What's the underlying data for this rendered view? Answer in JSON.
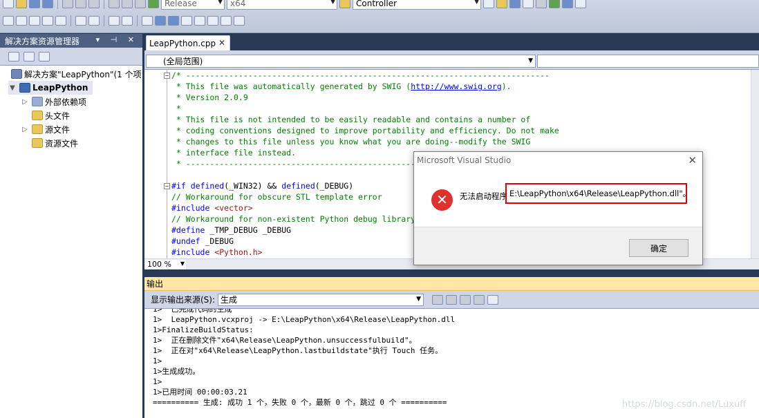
{
  "toolbar": {
    "config": "Release",
    "platform": "x64",
    "find": "Controller"
  },
  "solution_explorer": {
    "title": "解决方案资源管理器",
    "solution": "解决方案\"LeapPython\"(1 个项",
    "project": "LeapPython",
    "items": [
      {
        "label": "外部依赖项",
        "icon": "references-icon",
        "expandable": true
      },
      {
        "label": "头文件",
        "icon": "folder-icon",
        "expandable": false
      },
      {
        "label": "源文件",
        "icon": "folder-icon",
        "expandable": true
      },
      {
        "label": "资源文件",
        "icon": "folder-icon",
        "expandable": false
      }
    ]
  },
  "editor": {
    "tab": "LeapPython.cpp",
    "scope": "(全局范围)",
    "zoom": "100 %",
    "code": [
      {
        "t": "/* ----------------------------------------------------------------------------",
        "c": "cm"
      },
      {
        "t": " * This file was automatically generated by SWIG (",
        "c": "cm",
        "link": "http://www.swig.org",
        "tail": ")."
      },
      {
        "t": " * Version 2.0.9",
        "c": "cm"
      },
      {
        "t": " *",
        "c": "cm"
      },
      {
        "t": " * This file is not intended to be easily readable and contains a number of",
        "c": "cm"
      },
      {
        "t": " * coding conventions designed to improve portability and efficiency. Do not make",
        "c": "cm"
      },
      {
        "t": " * changes to this file unless you know what you are doing--modify the SWIG",
        "c": "cm"
      },
      {
        "t": " * interface file instead.",
        "c": "cm"
      },
      {
        "t": " * ----------------------------------------------------------------------------- */",
        "c": "cm"
      },
      {
        "t": "",
        "c": ""
      },
      {
        "t": "#if defined(_WIN32) && defined(_DEBUG)",
        "c": "pp"
      },
      {
        "t": "// Workaround for obscure STL template error",
        "c": "cm"
      },
      {
        "t": "#include <vector>",
        "c": "inc"
      },
      {
        "t": "// Workaround for non-existent Python debug library",
        "c": "cm"
      },
      {
        "t": "#define _TMP_DEBUG _DEBUG",
        "c": "def"
      },
      {
        "t": "#undef _DEBUG",
        "c": "def"
      },
      {
        "t": "#include <Python.h>",
        "c": "inc"
      }
    ]
  },
  "output": {
    "title": "输出",
    "source_label": "显示输出来源(S):",
    "source_value": "生成",
    "lines": [
      "1>  已完成代码的生成",
      "1>  LeapPython.vcxproj -> E:\\LeapPython\\x64\\Release\\LeapPython.dll",
      "1>FinalizeBuildStatus:",
      "1>  正在删除文件\"x64\\Release\\LeapPython.unsuccessfulbuild\"。",
      "1>  正在对\"x64\\Release\\LeapPython.lastbuildstate\"执行 Touch 任务。",
      "1>",
      "1>生成成功。",
      "1>",
      "1>已用时间 00:00:03.21",
      "========== 生成: 成功 1 个，失败 0 个，最新 0 个，跳过 0 个 =========="
    ]
  },
  "dialog": {
    "title": "Microsoft Visual Studio",
    "message_prefix": "无法启动程序",
    "path": "E:\\LeapPython\\x64\\Release\\LeapPython.dll\"。",
    "ok": "确定"
  },
  "watermark": "https://blog.csdn.net/Luxuff"
}
